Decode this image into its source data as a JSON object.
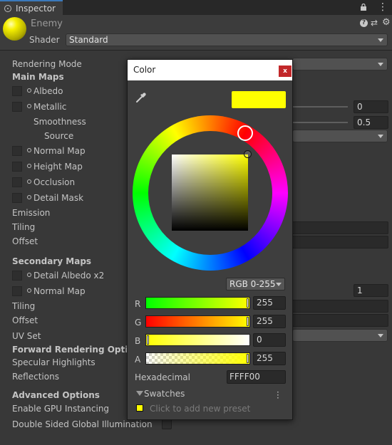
{
  "tab": {
    "label": "Inspector"
  },
  "header": {
    "object_name": "Enemy",
    "shader_label": "Shader",
    "shader_value": "Standard"
  },
  "properties": {
    "rendering_mode": "Rendering Mode",
    "main_maps": "Main Maps",
    "albedo": "Albedo",
    "metallic": "Metallic",
    "smoothness": "Smoothness",
    "source": "Source",
    "normal_map": "Normal Map",
    "height_map": "Height Map",
    "occlusion": "Occlusion",
    "detail_mask": "Detail Mask",
    "emission": "Emission",
    "tiling": "Tiling",
    "offset": "Offset",
    "secondary_maps": "Secondary Maps",
    "detail_albedo": "Detail Albedo x2",
    "normal_map_2": "Normal Map",
    "tiling_2": "Tiling",
    "offset_2": "Offset",
    "uv_set": "UV Set",
    "forward_rendering": "Forward Rendering Options",
    "specular_highlights": "Specular Highlights",
    "reflections": "Reflections",
    "advanced_options": "Advanced Options",
    "gpu_instancing": "Enable GPU Instancing",
    "double_sided_gi": "Double Sided Global Illumination",
    "metallic_value": "0",
    "smoothness_value": "0.5",
    "normal_scale_value": "1"
  },
  "color_picker": {
    "title": "Color",
    "close_label": "x",
    "current_color": "#ffff00",
    "mode": "RGB 0-255",
    "channels": [
      {
        "label": "R",
        "value": "255"
      },
      {
        "label": "G",
        "value": "255"
      },
      {
        "label": "B",
        "value": "0"
      },
      {
        "label": "A",
        "value": "255"
      }
    ],
    "hex_label": "Hexadecimal",
    "hex_value": "FFFF00",
    "swatches_label": "Swatches",
    "add_preset": "Click to add new preset"
  },
  "colors": {
    "accent": "#3a79bb",
    "close": "#c2282a",
    "selected": "#ffff00"
  }
}
